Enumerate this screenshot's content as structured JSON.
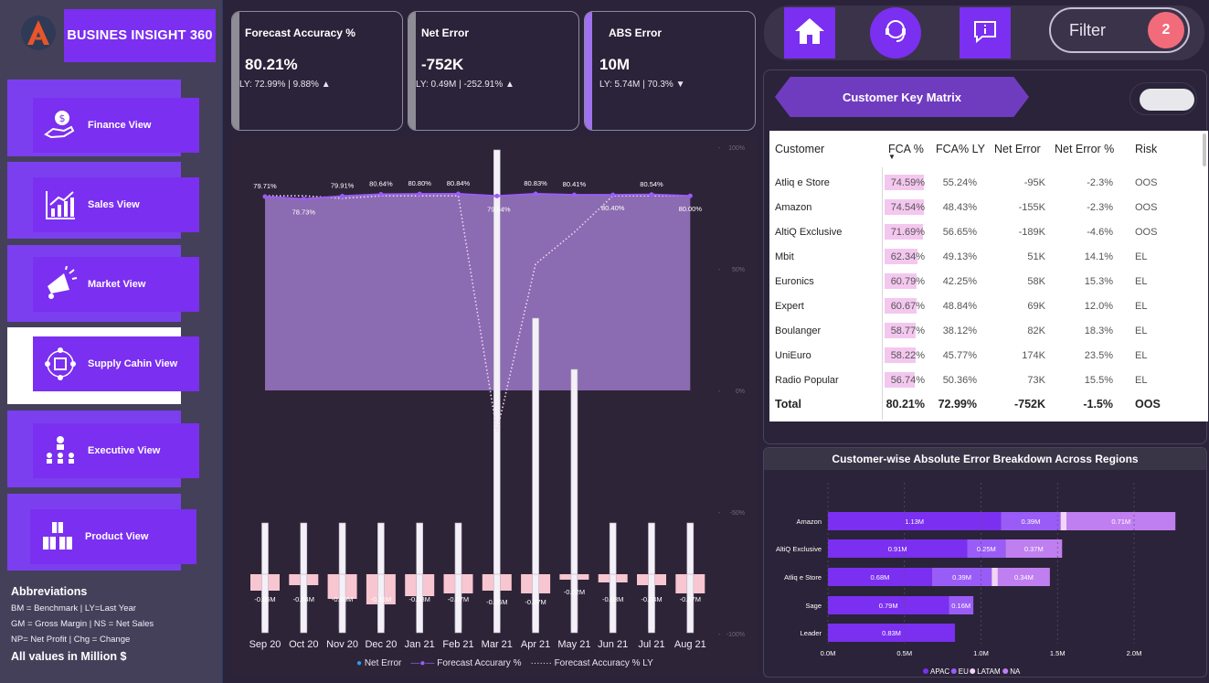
{
  "brand": "BUSINES INSIGHT 360",
  "nav": [
    {
      "label": "Finance View",
      "icon": "hand-coin-icon",
      "active": false
    },
    {
      "label": "Sales View",
      "icon": "growth-chart-icon",
      "active": false
    },
    {
      "label": "Market View",
      "icon": "megaphone-icon",
      "active": false
    },
    {
      "label": "Supply Cahin View",
      "icon": "supply-network-icon",
      "active": true
    },
    {
      "label": "Executive View",
      "icon": "team-hierarchy-icon",
      "active": false
    },
    {
      "label": "Product View",
      "icon": "boxes-icon",
      "active": false
    }
  ],
  "abbreviations": {
    "title": "Abbreviations",
    "lines": [
      "BM = Benchmark | LY=Last Year",
      "GM = Gross Margin | NS = Net Sales",
      "NP= Net Profit | Chg = Change"
    ],
    "footer": "All values in Million $"
  },
  "kpis": [
    {
      "title": "Forecast Accuracy %",
      "value": "80.21%",
      "sub": "LY: 72.99% | 9.88% ▲",
      "accent": "#8e8c94"
    },
    {
      "title": "Net Error",
      "value": "-752K",
      "sub": "LY: 0.49M | -252.91% ▲",
      "accent": "#8e8c94"
    },
    {
      "title": "ABS Error",
      "value": "10M",
      "sub": "LY: 5.74M | 70.3% ▼",
      "accent": "#a072f0"
    }
  ],
  "topnav": {
    "icons": [
      "home-icon",
      "support-headset-icon",
      "info-icon"
    ],
    "filter_label": "Filter",
    "filter_count": "2"
  },
  "matrix": {
    "title": "Customer Key Matrix",
    "columns": [
      "Customer",
      "FCA %",
      "FCA% LY",
      "Net Error",
      "Net Error %",
      "Risk"
    ],
    "rows": [
      {
        "customer": "Atliq e Store",
        "fca": "74.59%",
        "fca_val": 74.59,
        "fca_ly": "55.24%",
        "net_error": "-95K",
        "net_error_pct": "-2.3%",
        "risk": "OOS"
      },
      {
        "customer": "Amazon",
        "fca": "74.54%",
        "fca_val": 74.54,
        "fca_ly": "48.43%",
        "net_error": "-155K",
        "net_error_pct": "-2.3%",
        "risk": "OOS"
      },
      {
        "customer": "AltiQ Exclusive",
        "fca": "71.69%",
        "fca_val": 71.69,
        "fca_ly": "56.65%",
        "net_error": "-189K",
        "net_error_pct": "-4.6%",
        "risk": "OOS"
      },
      {
        "customer": "Mbit",
        "fca": "62.34%",
        "fca_val": 62.34,
        "fca_ly": "49.13%",
        "net_error": "51K",
        "net_error_pct": "14.1%",
        "risk": "EL"
      },
      {
        "customer": "Euronics",
        "fca": "60.79%",
        "fca_val": 60.79,
        "fca_ly": "42.25%",
        "net_error": "58K",
        "net_error_pct": "15.3%",
        "risk": "EL"
      },
      {
        "customer": "Expert",
        "fca": "60.67%",
        "fca_val": 60.67,
        "fca_ly": "48.84%",
        "net_error": "69K",
        "net_error_pct": "12.0%",
        "risk": "EL"
      },
      {
        "customer": "Boulanger",
        "fca": "58.77%",
        "fca_val": 58.77,
        "fca_ly": "38.12%",
        "net_error": "82K",
        "net_error_pct": "18.3%",
        "risk": "EL"
      },
      {
        "customer": "UniEuro",
        "fca": "58.22%",
        "fca_val": 58.22,
        "fca_ly": "45.77%",
        "net_error": "174K",
        "net_error_pct": "23.5%",
        "risk": "EL"
      },
      {
        "customer": "Radio Popular",
        "fca": "56.74%",
        "fca_val": 56.74,
        "fca_ly": "50.36%",
        "net_error": "73K",
        "net_error_pct": "15.5%",
        "risk": "EL"
      }
    ],
    "total": {
      "customer": "Total",
      "fca": "80.21%",
      "fca_ly": "72.99%",
      "net_error": "-752K",
      "net_error_pct": "-1.5%",
      "risk": "OOS"
    }
  },
  "chart_data": [
    {
      "type": "bar",
      "categories": [
        "Sep 20",
        "Oct 20",
        "Nov 20",
        "Dec 20",
        "Jan 21",
        "Feb 21",
        "Mar 21",
        "Apr 21",
        "May 21",
        "Jun 21",
        "Jul 21",
        "Aug 21"
      ],
      "y_right_ticks": [
        "100%",
        "50%",
        "0%",
        "-50%",
        "-100%"
      ],
      "series": [
        {
          "name": "Net Error",
          "kind": "bar",
          "values": [
            -0.06,
            -0.04,
            -0.09,
            -0.11,
            -0.08,
            -0.07,
            -0.06,
            -0.07,
            -0.02,
            -0.03,
            -0.04,
            -0.07
          ],
          "labels": [
            "-0.06M",
            "-0.04M",
            "-0.09M",
            "-0.11M",
            "-0.08M",
            "-0.07M",
            "-0.06M",
            "-0.07M",
            "-0.02M",
            "-0.03M",
            "-0.04M",
            "-0.07M"
          ]
        },
        {
          "name": "Forecast Accurary %",
          "kind": "line",
          "values": [
            79.71,
            78.73,
            79.91,
            80.64,
            80.8,
            80.84,
            79.94,
            80.83,
            80.41,
            80.4,
            80.54,
            80.0
          ],
          "labels": [
            "79.71%",
            "78.73%",
            "79.91%",
            "80.64%",
            "80.80%",
            "80.84%",
            "79.94%",
            "80.83%",
            "80.41%",
            "80.40%",
            "80.54%",
            "80.00%"
          ]
        },
        {
          "name": "Forecast Accuracy % LY",
          "kind": "line-dotted",
          "values": [
            80,
            80,
            79,
            80,
            80,
            80,
            -17,
            52,
            65,
            80,
            80,
            80
          ]
        },
        {
          "name": "ABS Error",
          "kind": "column",
          "values": [
            0.7,
            0.7,
            0.7,
            0.7,
            0.7,
            0.7,
            5.8,
            3.5,
            2.8,
            0.7,
            0.7,
            0.7
          ]
        }
      ],
      "legend": [
        "Net Error",
        "Forecast Accurary %",
        "Forecast Accuracy % LY"
      ],
      "colors": {
        "net_error": "#f7c6d0",
        "fca": "#9a5cf7",
        "fca_ly": "#f3d4f7",
        "area": "#9b78c7"
      }
    },
    {
      "type": "bar",
      "title": "Customer-wise Absolute Error Breakdown Across Regions",
      "categories": [
        "Amazon",
        "AltiQ Exclusive",
        "Atliq e Store",
        "Sage",
        "Leader"
      ],
      "xlim": [
        0,
        2.2
      ],
      "x_ticks": [
        "0.0M",
        "0.5M",
        "1.0M",
        "1.5M",
        "2.0M"
      ],
      "series": [
        {
          "name": "APAC",
          "values": [
            1.13,
            0.91,
            0.68,
            0.79,
            0.83
          ],
          "labels": [
            "1.13M",
            "0.91M",
            "0.68M",
            "0.79M",
            "0.83M"
          ],
          "color": "#7b2ff0"
        },
        {
          "name": "EU",
          "values": [
            0.39,
            0.25,
            0.39,
            0.16,
            0
          ],
          "labels": [
            "0.39M",
            "0.25M",
            "0.39M",
            "0.16M",
            ""
          ],
          "color": "#9a5cf7"
        },
        {
          "name": "LATAM",
          "values": [
            0.04,
            0,
            0.04,
            0,
            0
          ],
          "labels": [
            "",
            "",
            "",
            "",
            ""
          ],
          "color": "#f3d4f7"
        },
        {
          "name": "NA",
          "values": [
            0.71,
            0.37,
            0.34,
            0,
            0
          ],
          "labels": [
            "0.71M",
            "0.37M",
            "0.34M",
            "",
            ""
          ],
          "color": "#c07ff0"
        }
      ],
      "legend": [
        "APAC",
        "EU",
        "LATAM",
        "NA"
      ]
    }
  ]
}
